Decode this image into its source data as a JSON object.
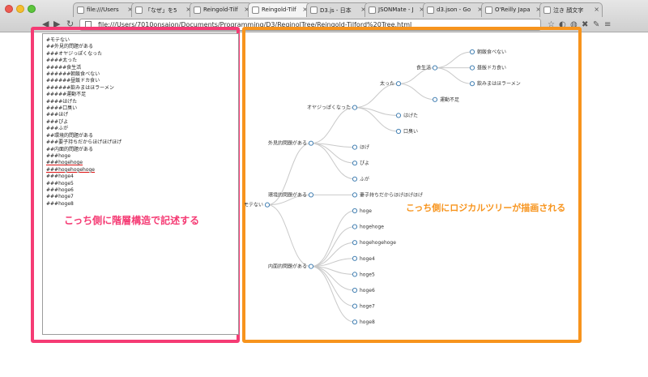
{
  "browser": {
    "tabs": [
      {
        "label": "file:///Users",
        "active": false
      },
      {
        "label": "「なぜ」を5",
        "active": false
      },
      {
        "label": "Reingold-Tilf",
        "active": false
      },
      {
        "label": "Reingold-Tilf",
        "active": true
      },
      {
        "label": "D3.js - 日本",
        "active": false
      },
      {
        "label": "JSONMate - J",
        "active": false
      },
      {
        "label": "d3.json - Go",
        "active": false
      },
      {
        "label": "O'Reilly Japa",
        "active": false
      },
      {
        "label": "泣き 顔文字",
        "active": false
      }
    ],
    "url": "file:///Users/7010onsaion/Documents/Programming/D3/ReginolTree/Reingold-Tilford%20Tree.html"
  },
  "editor": {
    "lines": [
      "#モテない",
      "##外見的問題がある",
      "###オヤジっぽくなった",
      "####太った",
      "#####食生活",
      "######朝飯食べない",
      "######昼飯ドカ食い",
      "######飲みまはほラーメン",
      "#####運動不足",
      "####はげた",
      "####口臭い",
      "###ほげ",
      "###ぴよ",
      "###ふが",
      "##環境的問題がある",
      "###要子持ちだからほげほげほげ",
      "##内面的問題がある",
      "###hoge",
      "###hogehoge",
      "###hogehogehoge",
      "###hoge4",
      "###hoge5",
      "###hoge6",
      "###hoge7",
      "###hoge8"
    ],
    "caption": "こっち側に階層構造で記述する"
  },
  "tree": {
    "caption": "こっち側にロジカルツリーが描画される",
    "root": {
      "name": "モテない",
      "children": [
        {
          "name": "外見的問題がある",
          "children": [
            {
              "name": "オヤジっぽくなった",
              "children": [
                {
                  "name": "太った",
                  "children": [
                    {
                      "name": "食生活",
                      "children": [
                        {
                          "name": "朝飯食べない"
                        },
                        {
                          "name": "昼飯ドカ食い"
                        },
                        {
                          "name": "飲みまはほラーメン"
                        }
                      ]
                    },
                    {
                      "name": "運動不足"
                    }
                  ]
                },
                {
                  "name": "はげた"
                },
                {
                  "name": "口臭い"
                }
              ]
            },
            {
              "name": "ほげ"
            },
            {
              "name": "ぴよ"
            },
            {
              "name": "ふが"
            }
          ]
        },
        {
          "name": "環境的問題がある",
          "children": [
            {
              "name": "妻子持ちだからほげほげほげ"
            }
          ]
        },
        {
          "name": "内面的問題がある",
          "children": [
            {
              "name": "hoge"
            },
            {
              "name": "hogehoge"
            },
            {
              "name": "hogehogehoge"
            },
            {
              "name": "hoge4"
            },
            {
              "name": "hoge5"
            },
            {
              "name": "hoge6"
            },
            {
              "name": "hoge7"
            },
            {
              "name": "hoge8"
            }
          ]
        }
      ]
    }
  }
}
